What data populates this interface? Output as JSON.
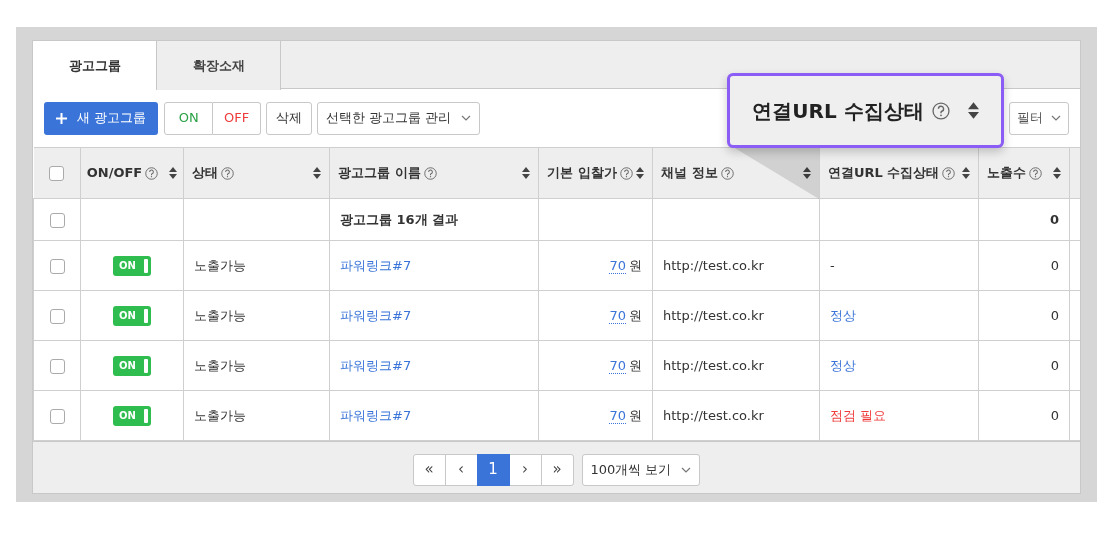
{
  "tabs": [
    {
      "label": "광고그룹",
      "selected": true
    },
    {
      "label": "확장소재",
      "selected": false
    }
  ],
  "toolbar": {
    "new_button": "새 광고그룹",
    "on_button": "ON",
    "off_button": "OFF",
    "delete_button": "삭제",
    "manage_dropdown": "선택한 광고그룹 관리",
    "filter_dropdown": "필터"
  },
  "callout": {
    "label": "연결URL 수집상태"
  },
  "table": {
    "select_all": {
      "checked": false
    },
    "columns": [
      {
        "label": "ON/OFF"
      },
      {
        "label": "상태"
      },
      {
        "label": "광고그룹 이름"
      },
      {
        "label": "기본 입찰가"
      },
      {
        "label": "채널 정보"
      },
      {
        "label": "연결URL 수집상태"
      },
      {
        "label": "노출수"
      }
    ],
    "summary": {
      "checked": false,
      "label": "광고그룹 16개 결과",
      "impressions": "0"
    },
    "rows": [
      {
        "checked": false,
        "toggle": "ON",
        "on": true,
        "status": "노출가능",
        "name": "파워링크#7",
        "bid": "70",
        "unit": "원",
        "channel": "http://test.co.kr",
        "url_status": {
          "text": "-",
          "kind": "none"
        },
        "impressions": "0"
      },
      {
        "checked": false,
        "toggle": "ON",
        "on": true,
        "status": "노출가능",
        "name": "파워링크#7",
        "bid": "70",
        "unit": "원",
        "channel": "http://test.co.kr",
        "url_status": {
          "text": "정상",
          "kind": "normal"
        },
        "impressions": "0"
      },
      {
        "checked": false,
        "toggle": "ON",
        "on": true,
        "status": "노출가능",
        "name": "파워링크#7",
        "bid": "70",
        "unit": "원",
        "channel": "http://test.co.kr",
        "url_status": {
          "text": "정상",
          "kind": "normal"
        },
        "impressions": "0"
      },
      {
        "checked": false,
        "toggle": "ON",
        "on": true,
        "status": "노출가능",
        "name": "파워링크#7",
        "bid": "70",
        "unit": "원",
        "channel": "http://test.co.kr",
        "url_status": {
          "text": "점검 필요",
          "kind": "check"
        },
        "impressions": "0"
      }
    ]
  },
  "pagination": {
    "pages": [
      {
        "label": "«",
        "selected": false
      },
      {
        "label": "‹",
        "selected": false
      },
      {
        "label": "1",
        "selected": true
      },
      {
        "label": "›",
        "selected": false
      },
      {
        "label": "»",
        "selected": false
      }
    ],
    "page_size": "100개씩 보기"
  }
}
